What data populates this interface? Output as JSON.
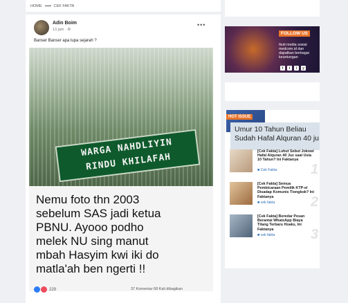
{
  "breadcrumb": {
    "home": "HOME",
    "current": "CEK FAKTA"
  },
  "post": {
    "author": "Adin Boim",
    "meta": "13 jam · ⚙",
    "text": "Banser Banser apa lupa sejarah ?",
    "banner_line1": "WARGA NAHDLIYIN",
    "banner_line2": "RINDU KHILAFAH",
    "caption": [
      "Nemu foto thn 2003",
      "sebelum SAS jadi ketua",
      "PBNU. Ayooo podho",
      "melek NU sing manut",
      "mbah Hasyim kwi iki do",
      "matla'ah ben ngerti !!"
    ],
    "reactions": "229",
    "stats": "37 Komentar  68 Kali dibagikan"
  },
  "follow": {
    "title": "FOLLOW US",
    "text": "Ikuti media sosial medcom.id dan dapatkan berbagai keuntungan",
    "socials": [
      "f",
      "t",
      "i",
      "y"
    ]
  },
  "hot": {
    "label": "HOT ISSUE",
    "hero_text": "Umur 10 Tahun Beliau Sudah Hafal Alquran 40 ju",
    "items": [
      {
        "title": "[Cek Fakta] Luhut Sebut Jokowi Hafal Alquran 40 Juz saat Usia 10 Tahun? Ini Faktanya",
        "category": "Cek Fakta",
        "number": "1",
        "thumb_color": "#c9b7a3"
      },
      {
        "title": "[Cek Fakta] Semua Pembicaraan Pemilik KTP-el Disadap Komunis Tiongkok? Ini Faktanya",
        "category": "cek fakta",
        "number": "2",
        "thumb_color": "#c79b6a"
      },
      {
        "title": "[Cek Fakta] Beredar Pesan Berantai WhatsApp Biaya Tilang Terbaru Hoaks, Ini Faktanya",
        "category": "cek fakta",
        "number": "3",
        "thumb_color": "#7c8fa3"
      }
    ]
  }
}
